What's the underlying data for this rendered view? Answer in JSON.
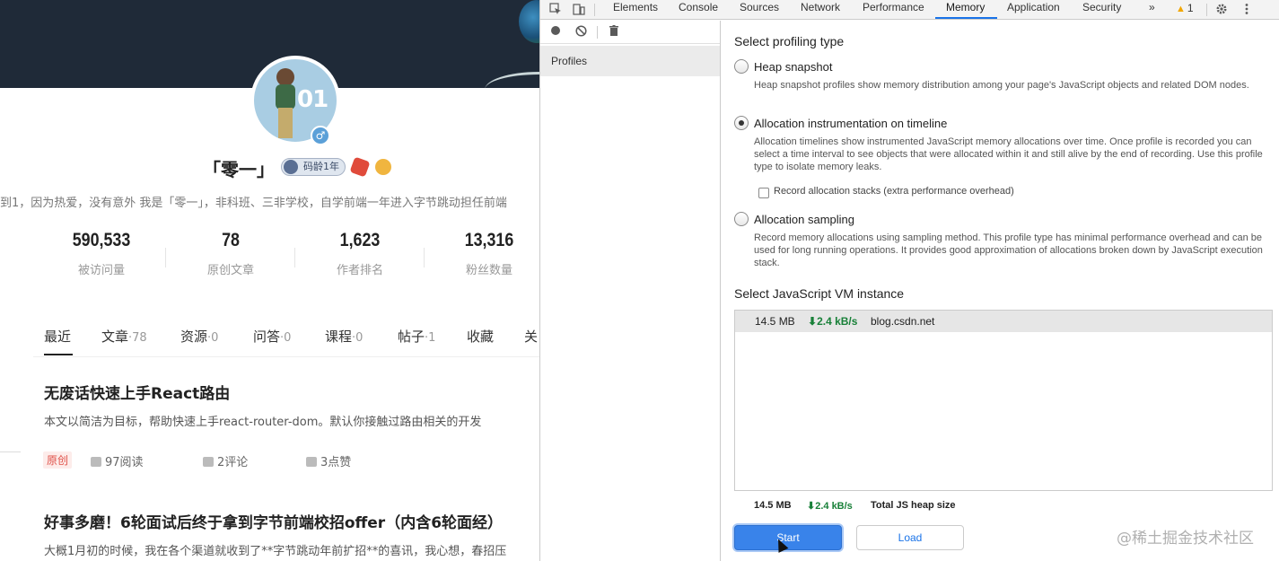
{
  "profile": {
    "username": "「零一」",
    "code_age_badge": "码龄1年",
    "avatar_digits": "01",
    "gender_symbol": "♂",
    "bio": "到1，因为热爱，没有意外 我是「零一」，非科班、三非学校，自学前端一年进入字节跳动担任前端"
  },
  "stats": [
    {
      "value": "590,533",
      "label": "被访问量"
    },
    {
      "value": "78",
      "label": "原创文章"
    },
    {
      "value": "1,623",
      "label": "作者排名"
    },
    {
      "value": "13,316",
      "label": "粉丝数量"
    }
  ],
  "tabs": [
    {
      "label": "最近",
      "count": ""
    },
    {
      "label": "文章",
      "count": "·78"
    },
    {
      "label": "资源",
      "count": "·0"
    },
    {
      "label": "问答",
      "count": "·0"
    },
    {
      "label": "课程",
      "count": "·0"
    },
    {
      "label": "帖子",
      "count": "·1"
    },
    {
      "label": "收藏",
      "count": ""
    },
    {
      "label": "关",
      "count": ""
    }
  ],
  "articles": [
    {
      "title": "无废话快速上手React路由",
      "desc": "本文以简洁为目标，帮助快速上手react-router-dom。默认你接触过路由相关的开发",
      "tag": "原创",
      "reads": "97阅读",
      "comments": "2评论",
      "likes": "3点赞"
    },
    {
      "title": "好事多磨！6轮面试后终于拿到字节前端校招offer（内含6轮面经）",
      "desc": "大概1月初的时候，我在各个渠道就收到了**字节跳动年前扩招**的喜讯，我心想，春招压"
    }
  ],
  "devtools": {
    "tabs": [
      "Elements",
      "Console",
      "Sources",
      "Network",
      "Performance",
      "Memory",
      "Application",
      "Security"
    ],
    "more_symbol": "»",
    "warning_count": "1",
    "sidebar_header": "Profiles",
    "profiling_title": "Select profiling type",
    "options": [
      {
        "label": "Heap snapshot",
        "desc": "Heap snapshot profiles show memory distribution among your page's JavaScript objects and related DOM nodes.",
        "checked": false
      },
      {
        "label": "Allocation instrumentation on timeline",
        "desc": "Allocation timelines show instrumented JavaScript memory allocations over time. Once profile is recorded you can select a time interval to see objects that were allocated within it and still alive by the end of recording. Use this profile type to isolate memory leaks.",
        "checked": true
      },
      {
        "label": "Allocation sampling",
        "desc": "Record memory allocations using sampling method. This profile type has minimal performance overhead and can be used for long running operations. It provides good approximation of allocations broken down by JavaScript execution stack.",
        "checked": false
      }
    ],
    "record_stacks_label": "Record allocation stacks (extra performance overhead)",
    "vm_title": "Select JavaScript VM instance",
    "vm_instance": {
      "size": "14.5 MB",
      "rate": "2.4 kB/s",
      "host": "blog.csdn.net"
    },
    "totals": {
      "size": "14.5 MB",
      "rate": "2.4 kB/s",
      "label": "Total JS heap size"
    },
    "start_label": "Start",
    "load_label": "Load"
  },
  "watermark": "@稀土掘金技术社区",
  "colors": {
    "accent_blue": "#1a73e8",
    "start_button": "#3983ea",
    "rate_green": "#188038",
    "tag_red": "#e0524a"
  }
}
